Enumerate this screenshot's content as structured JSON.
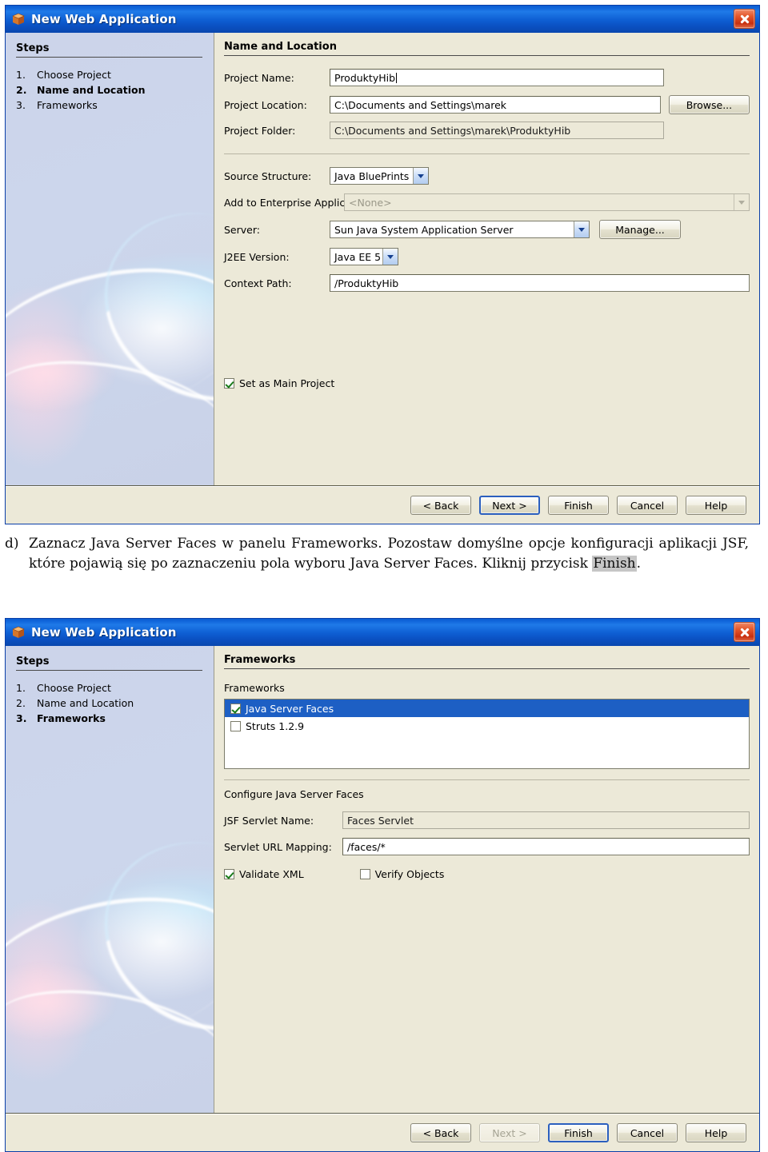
{
  "dialog1": {
    "window_title": "New Web Application",
    "title_icon": "app-box-icon",
    "close_label": "×",
    "steps": {
      "heading": "Steps",
      "items": [
        {
          "num": "1.",
          "label": "Choose Project",
          "current": false
        },
        {
          "num": "2.",
          "label": "Name and Location",
          "current": true
        },
        {
          "num": "3.",
          "label": "Frameworks",
          "current": false
        }
      ]
    },
    "pane_heading": "Name and Location",
    "fields": {
      "project_name_label": "Project Name:",
      "project_name_value": "ProduktyHib",
      "project_location_label": "Project Location:",
      "project_location_value": "C:\\Documents and Settings\\marek",
      "browse_label": "Browse...",
      "project_folder_label": "Project Folder:",
      "project_folder_value": "C:\\Documents and Settings\\marek\\ProduktyHib",
      "source_structure_label": "Source Structure:",
      "source_structure_value": "Java BluePrints",
      "enterprise_app_label": "Add to Enterprise Application:",
      "enterprise_app_value": "<None>",
      "server_label": "Server:",
      "server_value": "Sun Java System Application Server",
      "manage_label": "Manage...",
      "j2ee_version_label": "J2EE Version:",
      "j2ee_version_value": "Java EE 5",
      "context_path_label": "Context Path:",
      "context_path_value": "/ProduktyHib",
      "set_main_project_label": "Set as Main Project",
      "set_main_project_checked": true
    },
    "buttons": {
      "back": "< Back",
      "next": "Next >",
      "finish": "Finish",
      "cancel": "Cancel",
      "help": "Help",
      "default": "next",
      "disabled": []
    }
  },
  "instruction": {
    "marker": "d)",
    "text": "Zaznacz Java Server Faces w panelu Frameworks. Pozostaw domyślne opcje konfiguracji aplikacji JSF, które pojawią się po zaznaczeniu pola wyboru Java Server Faces. Kliknij przycisk ",
    "highlight": "Finish",
    "text_end": "."
  },
  "dialog2": {
    "window_title": "New Web Application",
    "title_icon": "app-box-icon",
    "close_label": "×",
    "steps": {
      "heading": "Steps",
      "items": [
        {
          "num": "1.",
          "label": "Choose Project",
          "current": false
        },
        {
          "num": "2.",
          "label": "Name and Location",
          "current": false
        },
        {
          "num": "3.",
          "label": "Frameworks",
          "current": true
        }
      ]
    },
    "pane_heading": "Frameworks",
    "frameworks": {
      "list_label": "Frameworks",
      "items": [
        {
          "label": "Java Server Faces",
          "checked": true,
          "selected": true
        },
        {
          "label": "Struts 1.2.9",
          "checked": false,
          "selected": false
        }
      ]
    },
    "configure": {
      "heading": "Configure Java Server Faces",
      "servlet_name_label": "JSF Servlet Name:",
      "servlet_name_value": "Faces Servlet",
      "url_mapping_label": "Servlet URL Mapping:",
      "url_mapping_value": "/faces/*",
      "validate_xml_label": "Validate XML",
      "validate_xml_checked": true,
      "verify_objects_label": "Verify Objects",
      "verify_objects_checked": false
    },
    "buttons": {
      "back": "< Back",
      "next": "Next >",
      "finish": "Finish",
      "cancel": "Cancel",
      "help": "Help",
      "default": "finish",
      "disabled": [
        "next"
      ]
    }
  },
  "colors": {
    "titlebar_blue": "#0e5fd4",
    "dialog_face": "#ece9d8",
    "steps_panel": "#ccd4ea",
    "selection_blue": "#1d5fc4",
    "close_red": "#c83010",
    "check_green": "#197b19",
    "highlight_gray": "#c6c6c6"
  }
}
